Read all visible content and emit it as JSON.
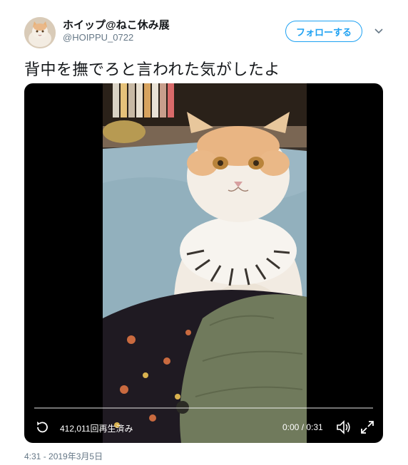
{
  "user": {
    "display_name": "ホイップ@ねこ休み展",
    "handle": "@HOIPPU_0722"
  },
  "follow_button": {
    "label": "フォローする"
  },
  "tweet": {
    "text": "背中を撫でろと言われた気がしたよ"
  },
  "video": {
    "views_label": "412,011回再生済み",
    "time_label": "0:00 / 0:31",
    "progress": 0
  },
  "timestamp": "4:31 - 2019年3月5日",
  "icons": {
    "caret": "chevron-down-icon",
    "replay": "replay-icon",
    "volume": "volume-icon",
    "fullscreen": "fullscreen-icon"
  },
  "colors": {
    "accent": "#1da1f2",
    "secondary_text": "#657786"
  }
}
